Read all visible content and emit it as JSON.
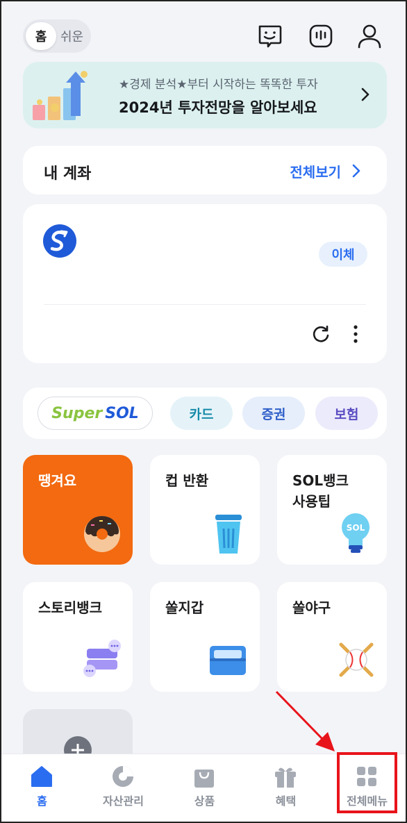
{
  "header": {
    "mode_active": "홈",
    "mode_inactive": "쉬운",
    "icons": [
      "chat-icon",
      "bot-icon",
      "profile-icon"
    ]
  },
  "banner": {
    "subtitle": "★경제 분석★부터 시작하는 똑똑한 투자",
    "title": "2024년 투자전망을 알아보세요"
  },
  "account_header": {
    "title": "내 계좌",
    "view_all": "전체보기"
  },
  "account_card": {
    "transfer_label": "이체"
  },
  "chips": {
    "super_a": "Super",
    "super_b": "SOL",
    "card": "카드",
    "stock": "증권",
    "insurance": "보험"
  },
  "tiles": [
    {
      "label": "땡겨요"
    },
    {
      "label": "컵 반환"
    },
    {
      "label": "SOL뱅크\n사용팁"
    },
    {
      "label": "스토리뱅크"
    },
    {
      "label": "쏠지갑"
    },
    {
      "label": "쏠야구"
    }
  ],
  "bottom_nav": [
    {
      "label": "홈",
      "icon": "home-icon",
      "active": true
    },
    {
      "label": "자산관리",
      "icon": "pie-chart-icon",
      "active": false
    },
    {
      "label": "상품",
      "icon": "shopping-bag-icon",
      "active": false
    },
    {
      "label": "혜택",
      "icon": "gift-icon",
      "active": false
    },
    {
      "label": "전체메뉴",
      "icon": "grid-menu-icon",
      "active": false
    }
  ],
  "colors": {
    "accent": "#2b6df0",
    "orange_tile": "#f36a10",
    "highlight": "#e8141b"
  }
}
